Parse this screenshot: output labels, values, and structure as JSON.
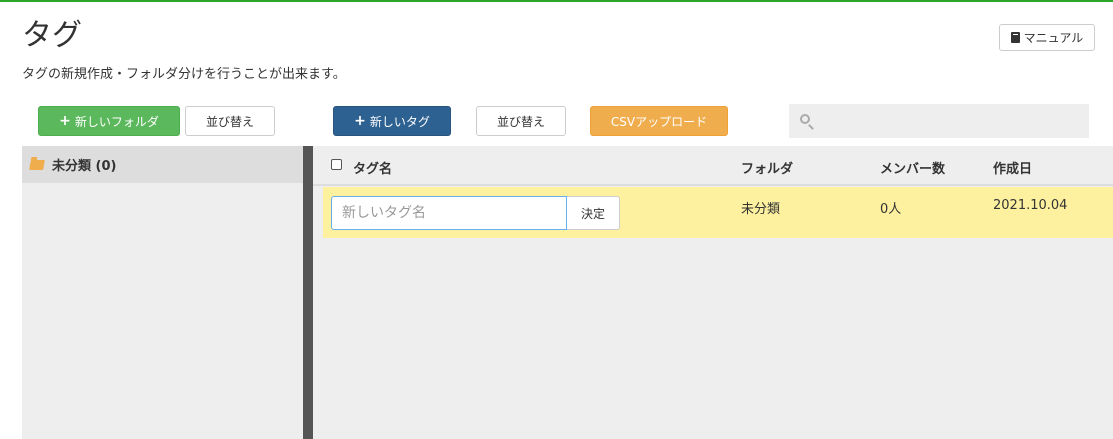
{
  "header": {
    "title": "タグ",
    "subtitle": "タグの新規作成・フォルダ分けを行うことが出来ます。",
    "manual_label": "マニュアル"
  },
  "toolbar": {
    "new_folder_label": "新しいフォルダ",
    "folder_sort_label": "並び替え",
    "new_tag_label": "新しいタグ",
    "tag_sort_label": "並び替え",
    "csv_upload_label": "CSVアップロード",
    "search_placeholder": ""
  },
  "folders": [
    {
      "label": "未分類 (0)",
      "icon": "folder-open-icon"
    }
  ],
  "table": {
    "columns": [
      "タグ名",
      "フォルダ",
      "メンバー数",
      "作成日"
    ],
    "new_row": {
      "input_placeholder": "新しいタグ名",
      "input_value": "",
      "decide_label": "決定",
      "folder": "未分類",
      "members": "0人",
      "created": "2021.10.04"
    }
  },
  "colors": {
    "accent_green": "#5cb85c",
    "primary_blue": "#2d6191",
    "warning_orange": "#f0ad4e",
    "highlight_row": "#fdf1a0"
  }
}
